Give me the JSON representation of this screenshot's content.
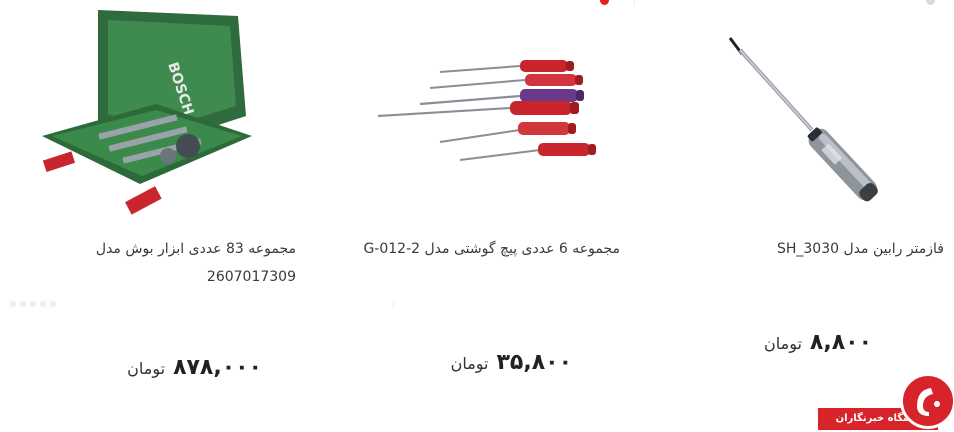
{
  "products": [
    {
      "name": "فازمتر رابین مدل SH_3030",
      "name_line2": "",
      "price": "۸,۸۰۰",
      "currency": "تومان"
    },
    {
      "name": "مجموعه 6 عددی پیچ گوشتی مدل G-012-2",
      "name_line2": "",
      "price": "۳۵,۸۰۰",
      "currency": "تومان"
    },
    {
      "name": "مجموعه 83 عددی ابزار بوش مدل",
      "name_line2": "2607017309",
      "price": "۸۷۸,۰۰۰",
      "currency": "تومان",
      "brand_text": "BOSCH"
    }
  ],
  "watermark": {
    "label": "باشگاه خبرنگاران"
  },
  "colors": {
    "accent": "#e0241b",
    "watermark_red": "#d8232a"
  }
}
